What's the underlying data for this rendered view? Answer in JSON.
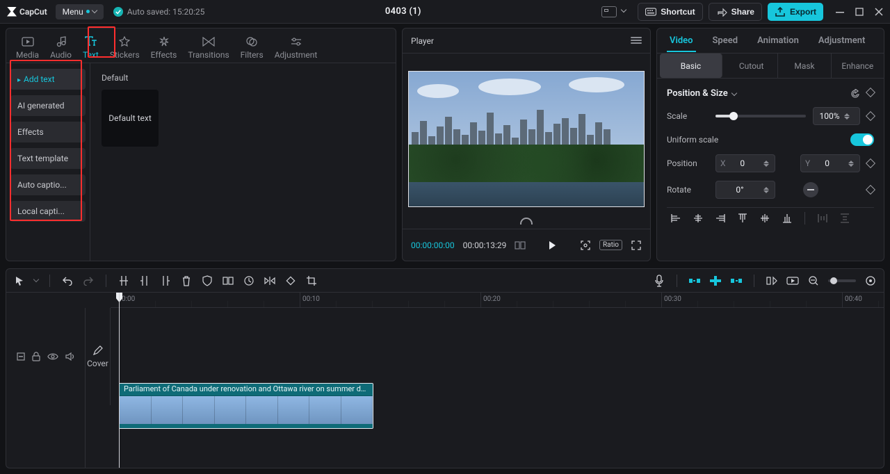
{
  "app": {
    "name": "CapCut"
  },
  "menu_label": "Menu",
  "autosaved": "Auto saved: 15:20:25",
  "project_title": "0403 (1)",
  "topbar_buttons": {
    "shortcut": "Shortcut",
    "share": "Share",
    "export": "Export"
  },
  "library_tabs": [
    {
      "label": "Media"
    },
    {
      "label": "Audio"
    },
    {
      "label": "Text"
    },
    {
      "label": "Stickers"
    },
    {
      "label": "Effects"
    },
    {
      "label": "Transitions"
    },
    {
      "label": "Filters"
    },
    {
      "label": "Adjustment"
    }
  ],
  "text_sub_items": [
    "Add text",
    "AI generated",
    "Effects",
    "Text template",
    "Auto captio...",
    "Local capti..."
  ],
  "default_heading": "Default",
  "default_thumb_label": "Default text",
  "player_title": "Player",
  "timecode_current": "00:00:00:00",
  "timecode_total": "00:00:13:29",
  "ratio_label": "Ratio",
  "inspector_tabs": [
    "Video",
    "Speed",
    "Animation",
    "Adjustment"
  ],
  "inspector_sub": [
    "Basic",
    "Cutout",
    "Mask",
    "Enhance"
  ],
  "section": "Position & Size",
  "scale_label": "Scale",
  "scale_value": "100%",
  "uniform_label": "Uniform scale",
  "position_label": "Position",
  "pos_x_label": "X",
  "pos_x_value": "0",
  "pos_y_label": "Y",
  "pos_y_value": "0",
  "rotate_label": "Rotate",
  "rotate_value": "0°",
  "timeline": {
    "cover_label": "Cover",
    "ruler": [
      {
        "pos": 12,
        "label": "0:00"
      },
      {
        "pos": 272,
        "label": "00:10"
      },
      {
        "pos": 532,
        "label": "00:20"
      },
      {
        "pos": 792,
        "label": "00:30"
      },
      {
        "pos": 1052,
        "label": "00:40"
      }
    ],
    "clip_title": "Parliament of Canada under renovation and Ottawa river on summer day"
  }
}
